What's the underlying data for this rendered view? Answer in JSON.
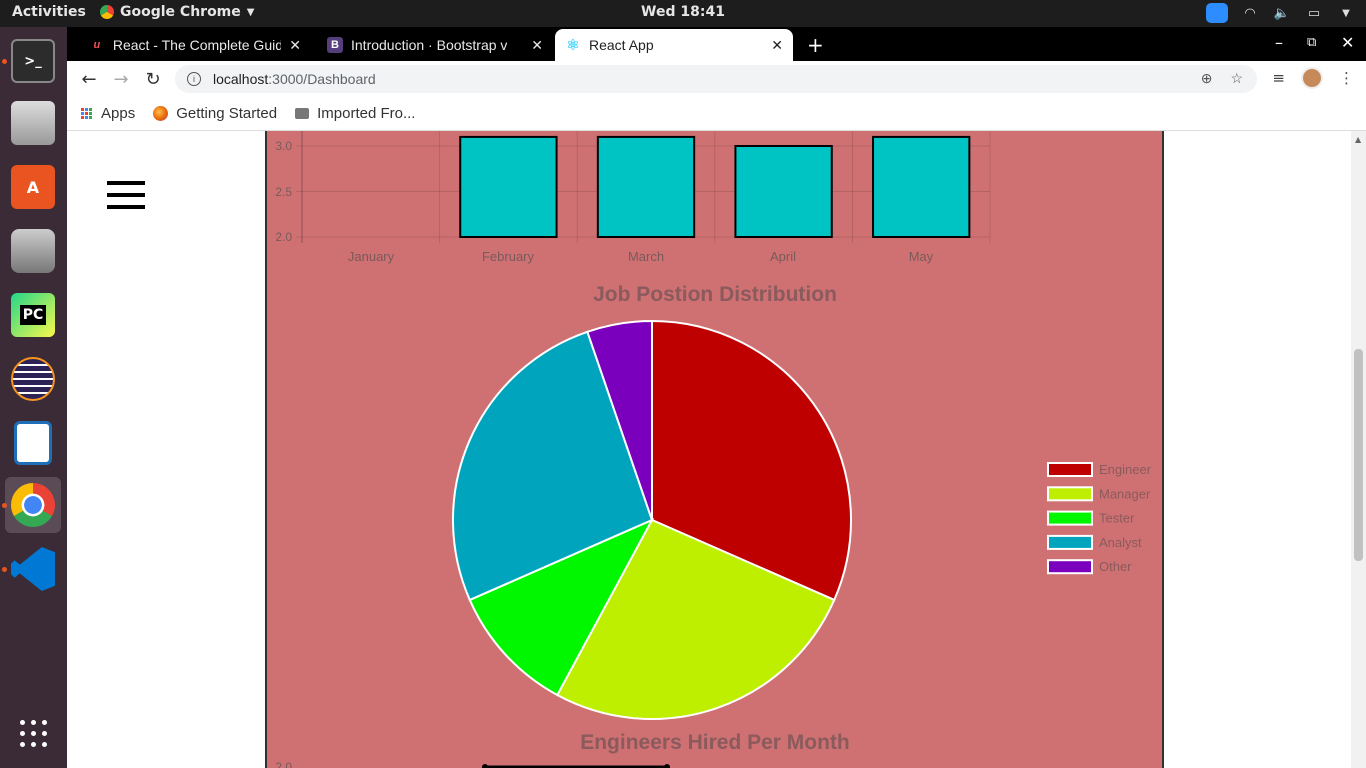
{
  "topbar": {
    "activities": "Activities",
    "app_name": "Google Chrome",
    "clock": "Wed 18:41"
  },
  "browser": {
    "tabs": [
      {
        "title": "React - The Complete Guid",
        "favicon": "udemy-icon",
        "favicon_color": "#ec5252",
        "active": false
      },
      {
        "title": "Introduction · Bootstrap v",
        "favicon": "bootstrap-icon",
        "favicon_color": "#563d7c",
        "active": false
      },
      {
        "title": "React App",
        "favicon": "react-icon",
        "favicon_color": "#61dafb",
        "active": true
      }
    ],
    "url_host": "localhost",
    "url_path": ":3000/Dashboard",
    "bookmarks": [
      {
        "label": "Apps",
        "icon": "apps-grid-icon"
      },
      {
        "label": "Getting Started",
        "icon": "firefox-icon"
      },
      {
        "label": "Imported Fro...",
        "icon": "folder-icon"
      }
    ]
  },
  "dashboard": {
    "panel_color": "#cf7173",
    "bar_chart_top": {
      "y_ticks": [
        "3.0",
        "2.5",
        "2.0"
      ],
      "categories": [
        "January",
        "February",
        "March",
        "April",
        "May"
      ]
    },
    "pie_title": "Job Postion Distribution",
    "next_chart_title": "Engineers Hired Per Month",
    "next_chart_first_tick": "2.0"
  },
  "chart_data": [
    {
      "type": "bar",
      "title": "",
      "categories": [
        "January",
        "February",
        "March",
        "April",
        "May"
      ],
      "values": [
        null,
        3.1,
        3.1,
        3.0,
        3.1
      ],
      "ylim": [
        2.0,
        3.1
      ],
      "color": "#00c4c4",
      "grid": true
    },
    {
      "type": "pie",
      "title": "Job Postion Distribution",
      "labels": [
        "Engineer",
        "Manager",
        "Tester",
        "Analyst",
        "Other"
      ],
      "values": [
        6,
        5,
        2,
        5,
        1
      ],
      "colors": [
        "#bf0000",
        "#bfef00",
        "#00f700",
        "#00a5bd",
        "#7b00bd"
      ],
      "legend": "right"
    }
  ]
}
